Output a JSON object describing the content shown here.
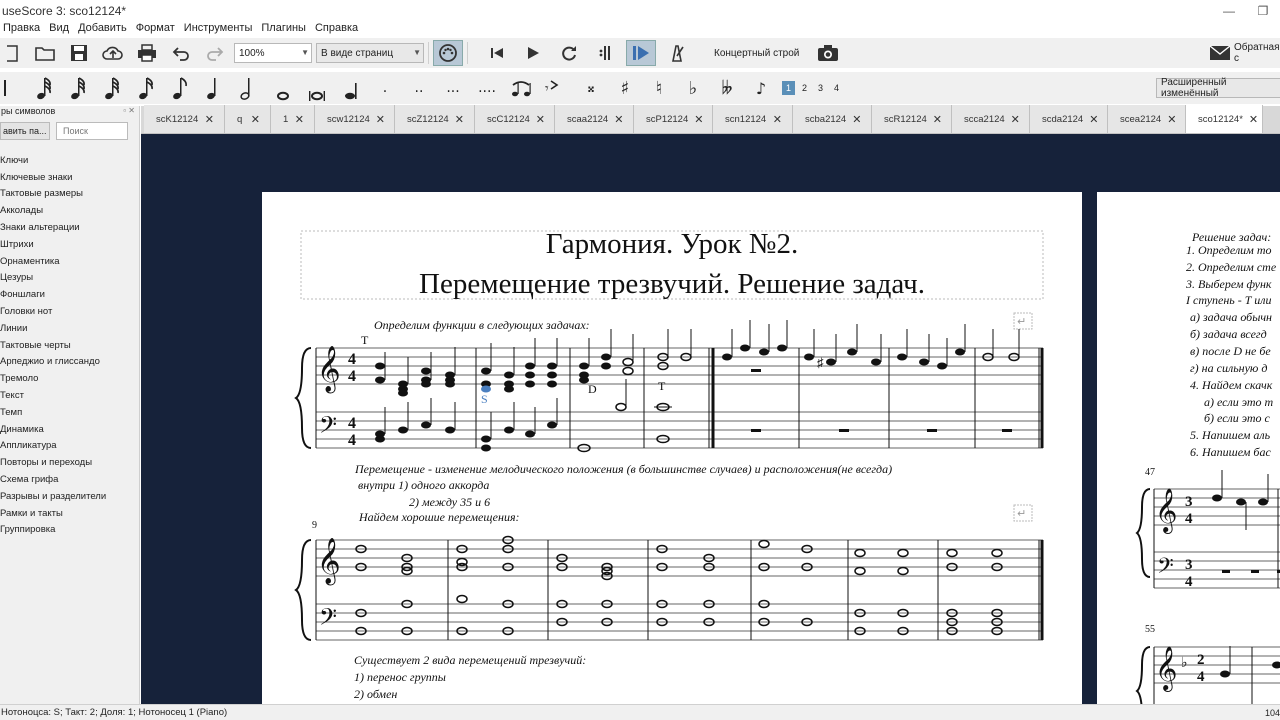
{
  "app": {
    "title": "useScore 3: sco12124*"
  },
  "menu": [
    "Правка",
    "Вид",
    "Добавить",
    "Формат",
    "Инструменты",
    "Плагины",
    "Справка"
  ],
  "toolbar": {
    "zoom_value": "100%",
    "view_mode": "В виде страниц",
    "concert_pitch": "Концертный строй",
    "feedback": "Обратная с"
  },
  "note_input": {
    "voices": [
      "1",
      "2",
      "3",
      "4"
    ],
    "workspace": "Расширенный изменённый"
  },
  "palette": {
    "header": "ры символов",
    "add_button": "авить па...",
    "search_placeholder": "Поиск",
    "items": [
      "Ключи",
      "Ключевые знаки",
      "Тактовые размеры",
      "Акколады",
      "Знаки альтерации",
      "Штрихи",
      "Орнаментика",
      "Цезуры",
      "Фоншлаги",
      "Головки нот",
      "Линии",
      "Тактовые черты",
      "Арпеджио и глиссандо",
      "Тремоло",
      "Текст",
      "Темп",
      "Динамика",
      "Аппликатура",
      "Повторы и переходы",
      "Схема грифа",
      "Разрывы и разделители",
      "Рамки и такты",
      "Группировка"
    ]
  },
  "tabs": [
    {
      "label": "scK12124"
    },
    {
      "label": "q"
    },
    {
      "label": "1"
    },
    {
      "label": "scw12124"
    },
    {
      "label": "scZ12124"
    },
    {
      "label": "scC12124"
    },
    {
      "label": "scaa2124"
    },
    {
      "label": "scP12124"
    },
    {
      "label": "scn12124"
    },
    {
      "label": "scba2124"
    },
    {
      "label": "scR12124"
    },
    {
      "label": "scca2124"
    },
    {
      "label": "scda2124"
    },
    {
      "label": "scea2124"
    },
    {
      "label": "sco12124*"
    }
  ],
  "score": {
    "title_line1": "Гармония. Урок №2.",
    "title_line2": "Перемещение трезвучий. Решение задач.",
    "instruction1": "Определим функции в следующих задачах:",
    "label_T": "T",
    "label_S": "S",
    "label_D": "D",
    "label_T2": "T",
    "def_text": "Перемещение - изменение мелодического положения (в большинстве случаев) и  расположения(не всегда)",
    "def_inside": "внутри  1) одного аккорда",
    "def_between": "2) между 35 и 6",
    "measure_9": "9",
    "find_text": "Найдем хорошие перемещения:",
    "types_text": "Существует 2 вида перемещений трезвучий:",
    "type1": "1) перенос группы",
    "type2": "2) обмен",
    "time_num": "4",
    "time_den": "4"
  },
  "page2": {
    "lines": [
      "Решение задач:",
      "1. Определим то",
      "2. Определим сте",
      "3. Выберем функ",
      "I ступень - T или",
      "а) задача обычн",
      "б) задача всегд",
      "в) после D не бе",
      "г) на сильную д",
      "4. Найдем скачк",
      "а) если это т",
      "б) если это с",
      "5. Напишем аль",
      "6. Напишем бас"
    ],
    "measure_47": "47",
    "measure_55": "55",
    "time_num": "3",
    "time_den": "4",
    "time2_num": "2",
    "time2_den": "4"
  },
  "status": {
    "text": "Нотоноцса: S;  Такт: 2; Доля: 1; Нотоносец 1 (Piano)",
    "zoom": "104"
  }
}
